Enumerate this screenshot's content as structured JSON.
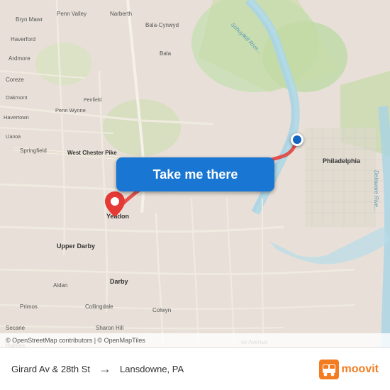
{
  "map": {
    "button_label": "Take me there",
    "attribution": "© OpenStreetMap contributors | © OpenMapTiles",
    "accent_color": "#1976D2",
    "pin_color": "#e53935",
    "route_color": "#e53935"
  },
  "bottom_bar": {
    "from": "Girard Av & 28th St",
    "to": "Lansdowne, PA",
    "arrow": "→",
    "brand": "moovit"
  },
  "map_labels": {
    "bryn_mawr": "Bryn Mawr",
    "haverford": "Haverford",
    "ardmore": "Ardmore",
    "narberth": "Narberth",
    "bala_cynwyd": "Bala-Cynwyd",
    "bala": "Bala",
    "penn_valley": "Penn Valley",
    "oakmont": "Oakmont",
    "penn_wynne": "Penn Wynne",
    "havertown": "Havertown",
    "penfield": "Penfield",
    "coreze": "Coreze",
    "schuylkill_river": "Schuylkill River",
    "west_chester_pike": "West Chester Pike",
    "yeadon": "Yeadon",
    "upper_darby": "Upper Darby",
    "darby": "Darby",
    "aldan": "Aldan",
    "primos": "Primos",
    "secane": "Secane",
    "collingdale": "Collingdale",
    "colwyn": "Colwyn",
    "sharon_hill": "Sharon Hill",
    "holmes": "Holmes",
    "springfield": "Springfield",
    "philadelphia": "Philadelphia",
    "delaware_river": "Delaware River"
  }
}
